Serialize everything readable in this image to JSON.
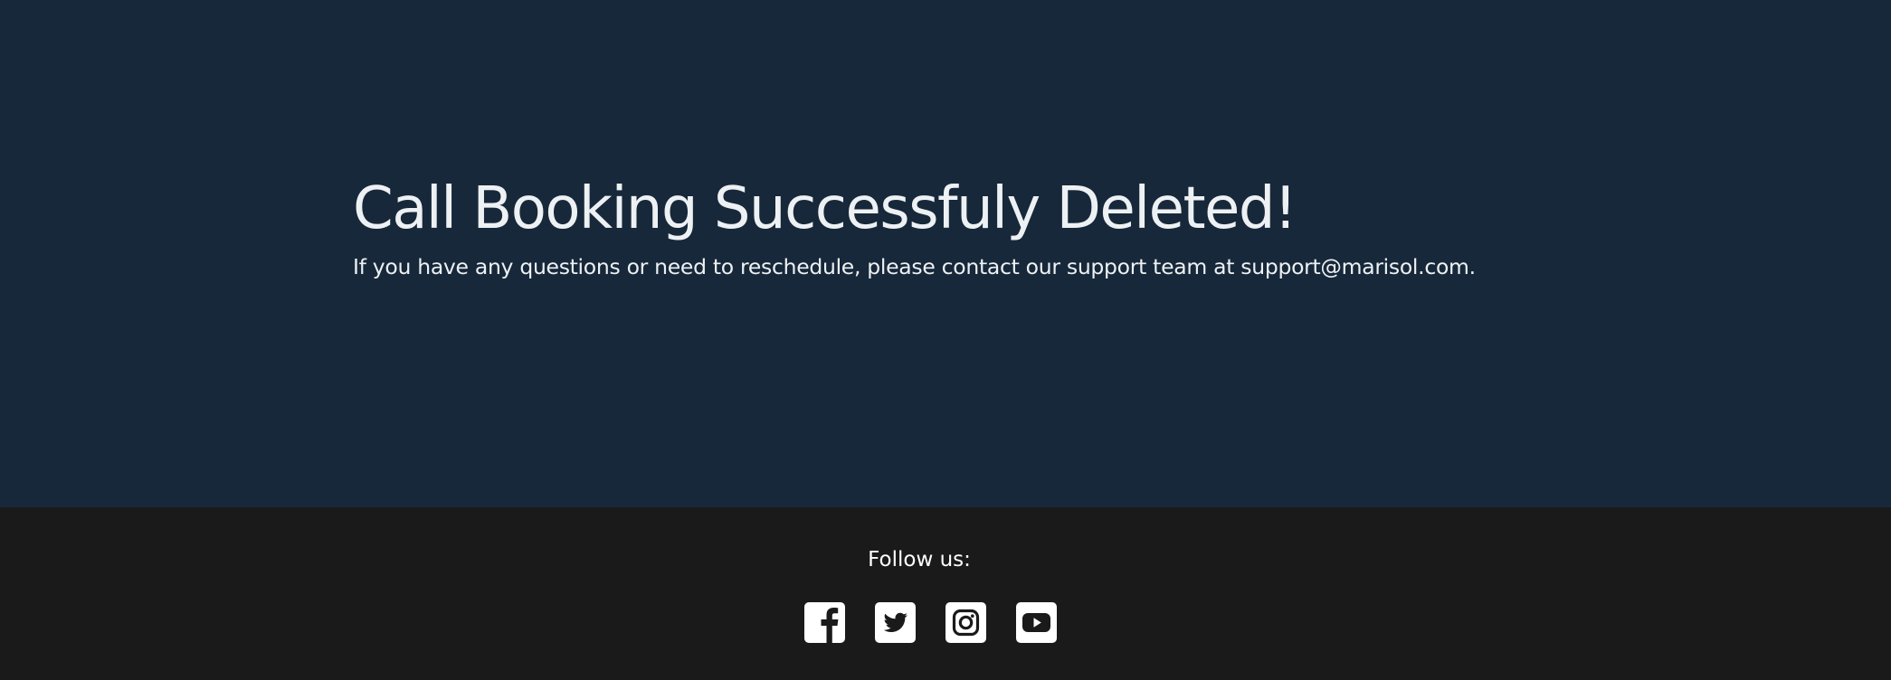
{
  "hero": {
    "title": "Call Booking Successfuly Deleted!",
    "message": "If you have any questions or need to reschedule, please contact our support team at support@marisol.com."
  },
  "footer": {
    "follow_label": "Follow us:",
    "social": [
      {
        "icon": "facebook-icon"
      },
      {
        "icon": "twitter-icon"
      },
      {
        "icon": "instagram-icon"
      },
      {
        "icon": "youtube-icon"
      }
    ]
  },
  "colors": {
    "hero_background": "#17283a",
    "footer_background": "#1a1a1a",
    "text": "#eef1f4",
    "icon": "#ffffff"
  }
}
